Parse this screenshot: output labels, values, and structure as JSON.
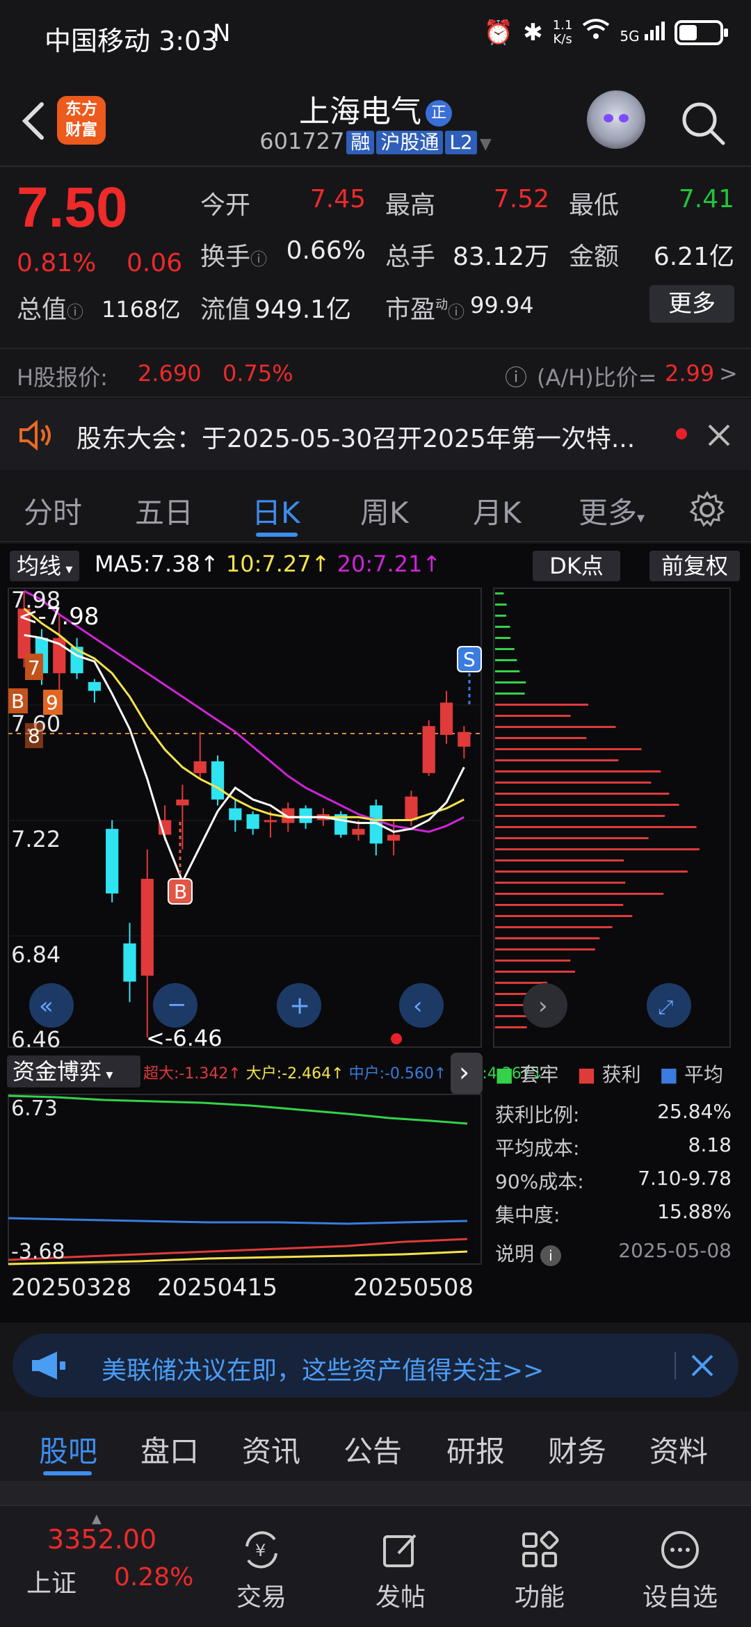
{
  "status": {
    "carrier_time": "中国移动 3:03",
    "nfc": "N",
    "net_speed_top": "1.1",
    "net_speed_bottom": "K/s",
    "signal": "5G"
  },
  "header": {
    "brand_line1": "东方",
    "brand_line2": "财富",
    "name": "上海电气",
    "badge": "正",
    "code": "601727",
    "tags": [
      "融",
      "沪股通",
      "L2"
    ]
  },
  "quote": {
    "price": "7.50",
    "change_pct": "0.81%",
    "change_amt": "0.06",
    "open_label": "今开",
    "open": "7.45",
    "high_label": "最高",
    "high": "7.52",
    "low_label": "最低",
    "low": "7.41",
    "turnover_label": "换手",
    "turnover": "0.66%",
    "volume_label": "总手",
    "volume": "83.12万",
    "amount_label": "金额",
    "amount": "6.21亿",
    "mcap_label": "总值",
    "mcap": "1168亿",
    "float_label": "流值",
    "float": "949.1亿",
    "pe_label": "市盈",
    "pe_sup": "动",
    "pe": "99.94",
    "more": "更多"
  },
  "hshare": {
    "label": "H股报价:",
    "price": "2.690",
    "pct": "0.75%",
    "ratio_label": "(A/H)比价=",
    "ratio": "2.99",
    "arrow": ">"
  },
  "notice": {
    "text": "股东大会：于2025-05-30召开2025年第一次特..."
  },
  "ktabs": [
    "分时",
    "五日",
    "日K",
    "周K",
    "月K",
    "更多"
  ],
  "chart": {
    "ma_btn": "均线",
    "ma5": "MA5:7.38↑",
    "ma10": "10:7.27↑",
    "ma20": "20:7.21↑",
    "dk_btn": "DK点",
    "fq_btn": "前复权",
    "y_labels": [
      "7.98",
      "7.60",
      "7.22",
      "6.84",
      "6.46"
    ],
    "hi_mark": "<-7.98",
    "lo_mark": "<-6.46",
    "signal_b": "B",
    "signal_s": "S",
    "left_marks": [
      "7",
      "B",
      "9",
      "8"
    ],
    "fund_btn": "资金博弈",
    "fund_super": "超大:-1.342↑",
    "fund_big": "大户:-2.464↑",
    "fund_mid": "中户:-0.560↑",
    "fund_small": "小户:4.367↓",
    "fund_top": "6.73",
    "fund_bottom": "-3.68",
    "dates": [
      "20250328",
      "20250415",
      "20250508"
    ],
    "colors": {
      "up": "#e03a3a",
      "down": "#2fe3f0",
      "ma5": "#ffffff",
      "ma10": "#f5e44a",
      "ma20": "#d024d8"
    }
  },
  "chart_data": {
    "type": "candlestick",
    "y_range": [
      6.46,
      7.98
    ],
    "candles": [
      {
        "o": 7.75,
        "c": 7.92,
        "h": 7.98,
        "l": 7.72
      },
      {
        "o": 7.82,
        "c": 7.7,
        "h": 7.85,
        "l": 7.66
      },
      {
        "o": 7.7,
        "c": 7.82,
        "h": 7.9,
        "l": 7.62
      },
      {
        "o": 7.79,
        "c": 7.7,
        "h": 7.82,
        "l": 7.68
      },
      {
        "o": 7.67,
        "c": 7.64,
        "h": 7.68,
        "l": 7.6
      },
      {
        "o": 7.17,
        "c": 6.95,
        "h": 7.2,
        "l": 6.92
      },
      {
        "o": 6.78,
        "c": 6.65,
        "h": 6.85,
        "l": 6.58
      },
      {
        "o": 6.67,
        "c": 7.0,
        "h": 7.1,
        "l": 6.46
      },
      {
        "o": 7.15,
        "c": 7.2,
        "h": 7.25,
        "l": 7.13
      },
      {
        "o": 7.25,
        "c": 7.27,
        "h": 7.32,
        "l": 7.1
      },
      {
        "o": 7.36,
        "c": 7.4,
        "h": 7.5,
        "l": 7.34
      },
      {
        "o": 7.4,
        "c": 7.27,
        "h": 7.42,
        "l": 7.25
      },
      {
        "o": 7.24,
        "c": 7.2,
        "h": 7.27,
        "l": 7.16
      },
      {
        "o": 7.22,
        "c": 7.17,
        "h": 7.23,
        "l": 7.15
      },
      {
        "o": 7.2,
        "c": 7.2,
        "h": 7.23,
        "l": 7.14
      },
      {
        "o": 7.19,
        "c": 7.24,
        "h": 7.26,
        "l": 7.16
      },
      {
        "o": 7.24,
        "c": 7.19,
        "h": 7.25,
        "l": 7.17
      },
      {
        "o": 7.2,
        "c": 7.22,
        "h": 7.24,
        "l": 7.18
      },
      {
        "o": 7.22,
        "c": 7.15,
        "h": 7.23,
        "l": 7.14
      },
      {
        "o": 7.15,
        "c": 7.17,
        "h": 7.2,
        "l": 7.13
      },
      {
        "o": 7.25,
        "c": 7.12,
        "h": 7.27,
        "l": 7.08
      },
      {
        "o": 7.13,
        "c": 7.15,
        "h": 7.2,
        "l": 7.08
      },
      {
        "o": 7.2,
        "c": 7.28,
        "h": 7.3,
        "l": 7.18
      },
      {
        "o": 7.36,
        "c": 7.52,
        "h": 7.54,
        "l": 7.35
      },
      {
        "o": 7.49,
        "c": 7.6,
        "h": 7.64,
        "l": 7.46
      },
      {
        "o": 7.45,
        "c": 7.5,
        "h": 7.52,
        "l": 7.41
      }
    ],
    "ma5": [
      7.83,
      7.82,
      7.8,
      7.76,
      7.74,
      7.63,
      7.51,
      7.34,
      7.14,
      6.99,
      7.11,
      7.23,
      7.31,
      7.27,
      7.25,
      7.21,
      7.21,
      7.21,
      7.2,
      7.19,
      7.19,
      7.16,
      7.17,
      7.2,
      7.26,
      7.38
    ],
    "ma10": [
      7.92,
      7.87,
      7.83,
      7.78,
      7.75,
      7.7,
      7.62,
      7.52,
      7.44,
      7.38,
      7.34,
      7.31,
      7.27,
      7.24,
      7.22,
      7.21,
      7.21,
      7.21,
      7.21,
      7.21,
      7.2,
      7.2,
      7.2,
      7.22,
      7.24,
      7.27
    ],
    "ma20": [
      7.98,
      7.95,
      7.9,
      7.86,
      7.82,
      7.78,
      7.74,
      7.7,
      7.66,
      7.62,
      7.58,
      7.54,
      7.5,
      7.45,
      7.4,
      7.35,
      7.31,
      7.28,
      7.25,
      7.22,
      7.2,
      7.18,
      7.17,
      7.16,
      7.18,
      7.21
    ],
    "chip_profit_bars": 18,
    "chip_loss_bars": 14
  },
  "chip": {
    "legend_a": "套牢",
    "legend_b": "获利",
    "legend_c": "平均",
    "rows": [
      {
        "label": "获利比例:",
        "value": "25.84%"
      },
      {
        "label": "平均成本:",
        "value": "8.18"
      },
      {
        "label": "90%成本:",
        "value": "7.10-9.78"
      },
      {
        "label": "集中度:",
        "value": "15.88%"
      },
      {
        "label": "说明",
        "value": "2025-05-08"
      }
    ]
  },
  "ad": {
    "text": "美联储决议在即，这些资产值得关注>>"
  },
  "btabs": [
    "股吧",
    "盘口",
    "资讯",
    "公告",
    "研报",
    "财务",
    "资料"
  ],
  "nav": {
    "index_value": "3352.00",
    "index_name": "上证",
    "index_pct": "0.28%",
    "items": [
      "交易",
      "发帖",
      "功能",
      "设自选"
    ],
    "trade_icon_text": "¥"
  }
}
